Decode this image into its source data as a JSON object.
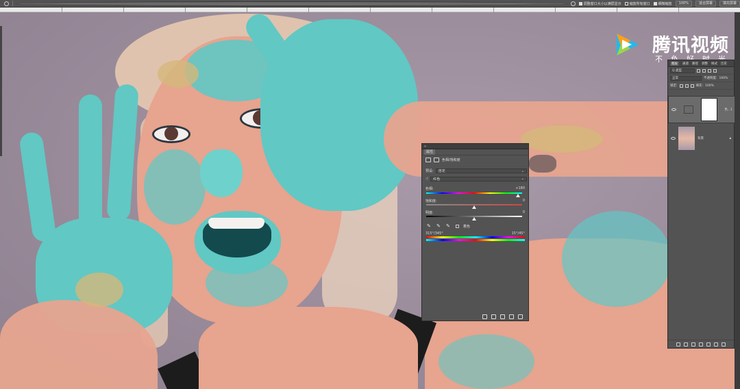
{
  "options_bar": {
    "resize_windows": "调整窗口大小以满屏显示",
    "zoom_all_windows": "缩放所有窗口",
    "scrubby_zoom": "细微缩放",
    "zoom_level": "100%",
    "fit_screen": "适合屏幕",
    "fill_screen": "填充屏幕"
  },
  "watermark": {
    "title": "腾讯视频",
    "subtitle": "不负好时光"
  },
  "properties": {
    "panel_title": "属性",
    "adjustment_name": "色相/饱和度",
    "preset_label": "预设:",
    "preset_value": "自定",
    "channel_value": "红色",
    "hue_label": "色相:",
    "hue_value": "+180",
    "hue_pos": 0.96,
    "saturation_label": "饱和度:",
    "saturation_value": "0",
    "saturation_pos": 0.5,
    "lightness_label": "明度:",
    "lightness_value": "0",
    "lightness_pos": 0.5,
    "colorize_label": "着色",
    "range_left": "315°/345°",
    "range_right": "15°/45°"
  },
  "layers": {
    "tabs": [
      "图层",
      "通道",
      "路径",
      "调整",
      "样式",
      "历史"
    ],
    "filter_label": "Q 类型",
    "blend_mode": "正常",
    "opacity_label": "不透明度:",
    "opacity_value": "100%",
    "lock_label": "锁定:",
    "fill_label": "填充:",
    "fill_value": "100%",
    "items": [
      {
        "name": "色...1",
        "selected": true
      },
      {
        "name": "背景",
        "selected": false
      }
    ]
  },
  "colors": {
    "canvas_bg": "#9c8e9d",
    "skin_cyan": "#61c8c4",
    "skin_peach": "#e7a48f",
    "panel_bg": "#535353",
    "watermark_logo": "#22b9f0"
  }
}
